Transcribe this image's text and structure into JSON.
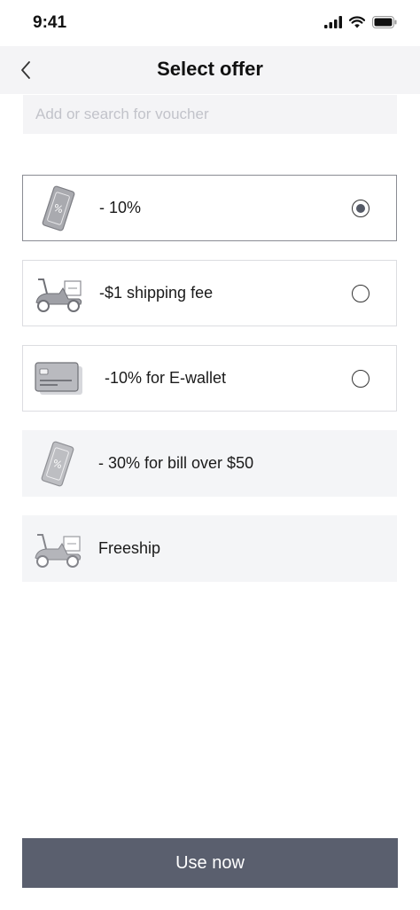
{
  "status_bar": {
    "time": "9:41"
  },
  "nav": {
    "title": "Select offer",
    "back_icon": "chevron-left-icon"
  },
  "search": {
    "placeholder": "Add or search for voucher",
    "value": ""
  },
  "offers": [
    {
      "label": "- 10%",
      "icon": "voucher-icon",
      "state": "selected"
    },
    {
      "label": "-$1 shipping fee",
      "icon": "scooter-icon",
      "state": "available"
    },
    {
      "label": "-10% for E-wallet",
      "icon": "card-icon",
      "state": "available"
    },
    {
      "label": "- 30% for bill over $50",
      "icon": "voucher-icon",
      "state": "disabled"
    },
    {
      "label": "Freeship",
      "icon": "scooter-icon",
      "state": "disabled"
    }
  ],
  "footer": {
    "use_label": "Use now"
  },
  "colors": {
    "primary_button": "#5a5f6e",
    "nav_background": "#f4f4f6",
    "disabled_card": "#f4f5f7"
  }
}
